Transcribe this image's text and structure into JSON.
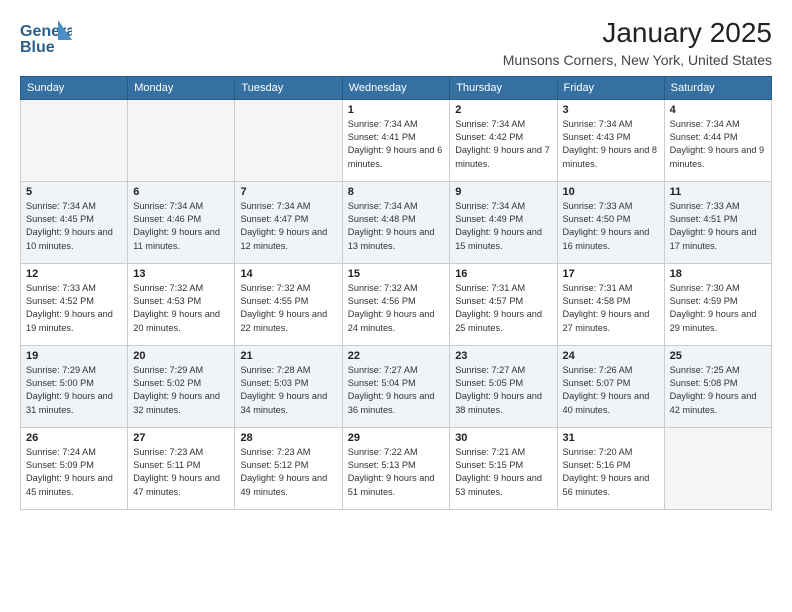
{
  "header": {
    "logo_line1": "General",
    "logo_line2": "Blue",
    "month_title": "January 2025",
    "location": "Munsons Corners, New York, United States"
  },
  "days_of_week": [
    "Sunday",
    "Monday",
    "Tuesday",
    "Wednesday",
    "Thursday",
    "Friday",
    "Saturday"
  ],
  "weeks": [
    [
      {
        "day": "",
        "info": ""
      },
      {
        "day": "",
        "info": ""
      },
      {
        "day": "",
        "info": ""
      },
      {
        "day": "1",
        "info": "Sunrise: 7:34 AM\nSunset: 4:41 PM\nDaylight: 9 hours and 6 minutes."
      },
      {
        "day": "2",
        "info": "Sunrise: 7:34 AM\nSunset: 4:42 PM\nDaylight: 9 hours and 7 minutes."
      },
      {
        "day": "3",
        "info": "Sunrise: 7:34 AM\nSunset: 4:43 PM\nDaylight: 9 hours and 8 minutes."
      },
      {
        "day": "4",
        "info": "Sunrise: 7:34 AM\nSunset: 4:44 PM\nDaylight: 9 hours and 9 minutes."
      }
    ],
    [
      {
        "day": "5",
        "info": "Sunrise: 7:34 AM\nSunset: 4:45 PM\nDaylight: 9 hours and 10 minutes."
      },
      {
        "day": "6",
        "info": "Sunrise: 7:34 AM\nSunset: 4:46 PM\nDaylight: 9 hours and 11 minutes."
      },
      {
        "day": "7",
        "info": "Sunrise: 7:34 AM\nSunset: 4:47 PM\nDaylight: 9 hours and 12 minutes."
      },
      {
        "day": "8",
        "info": "Sunrise: 7:34 AM\nSunset: 4:48 PM\nDaylight: 9 hours and 13 minutes."
      },
      {
        "day": "9",
        "info": "Sunrise: 7:34 AM\nSunset: 4:49 PM\nDaylight: 9 hours and 15 minutes."
      },
      {
        "day": "10",
        "info": "Sunrise: 7:33 AM\nSunset: 4:50 PM\nDaylight: 9 hours and 16 minutes."
      },
      {
        "day": "11",
        "info": "Sunrise: 7:33 AM\nSunset: 4:51 PM\nDaylight: 9 hours and 17 minutes."
      }
    ],
    [
      {
        "day": "12",
        "info": "Sunrise: 7:33 AM\nSunset: 4:52 PM\nDaylight: 9 hours and 19 minutes."
      },
      {
        "day": "13",
        "info": "Sunrise: 7:32 AM\nSunset: 4:53 PM\nDaylight: 9 hours and 20 minutes."
      },
      {
        "day": "14",
        "info": "Sunrise: 7:32 AM\nSunset: 4:55 PM\nDaylight: 9 hours and 22 minutes."
      },
      {
        "day": "15",
        "info": "Sunrise: 7:32 AM\nSunset: 4:56 PM\nDaylight: 9 hours and 24 minutes."
      },
      {
        "day": "16",
        "info": "Sunrise: 7:31 AM\nSunset: 4:57 PM\nDaylight: 9 hours and 25 minutes."
      },
      {
        "day": "17",
        "info": "Sunrise: 7:31 AM\nSunset: 4:58 PM\nDaylight: 9 hours and 27 minutes."
      },
      {
        "day": "18",
        "info": "Sunrise: 7:30 AM\nSunset: 4:59 PM\nDaylight: 9 hours and 29 minutes."
      }
    ],
    [
      {
        "day": "19",
        "info": "Sunrise: 7:29 AM\nSunset: 5:00 PM\nDaylight: 9 hours and 31 minutes."
      },
      {
        "day": "20",
        "info": "Sunrise: 7:29 AM\nSunset: 5:02 PM\nDaylight: 9 hours and 32 minutes."
      },
      {
        "day": "21",
        "info": "Sunrise: 7:28 AM\nSunset: 5:03 PM\nDaylight: 9 hours and 34 minutes."
      },
      {
        "day": "22",
        "info": "Sunrise: 7:27 AM\nSunset: 5:04 PM\nDaylight: 9 hours and 36 minutes."
      },
      {
        "day": "23",
        "info": "Sunrise: 7:27 AM\nSunset: 5:05 PM\nDaylight: 9 hours and 38 minutes."
      },
      {
        "day": "24",
        "info": "Sunrise: 7:26 AM\nSunset: 5:07 PM\nDaylight: 9 hours and 40 minutes."
      },
      {
        "day": "25",
        "info": "Sunrise: 7:25 AM\nSunset: 5:08 PM\nDaylight: 9 hours and 42 minutes."
      }
    ],
    [
      {
        "day": "26",
        "info": "Sunrise: 7:24 AM\nSunset: 5:09 PM\nDaylight: 9 hours and 45 minutes."
      },
      {
        "day": "27",
        "info": "Sunrise: 7:23 AM\nSunset: 5:11 PM\nDaylight: 9 hours and 47 minutes."
      },
      {
        "day": "28",
        "info": "Sunrise: 7:23 AM\nSunset: 5:12 PM\nDaylight: 9 hours and 49 minutes."
      },
      {
        "day": "29",
        "info": "Sunrise: 7:22 AM\nSunset: 5:13 PM\nDaylight: 9 hours and 51 minutes."
      },
      {
        "day": "30",
        "info": "Sunrise: 7:21 AM\nSunset: 5:15 PM\nDaylight: 9 hours and 53 minutes."
      },
      {
        "day": "31",
        "info": "Sunrise: 7:20 AM\nSunset: 5:16 PM\nDaylight: 9 hours and 56 minutes."
      },
      {
        "day": "",
        "info": ""
      }
    ]
  ]
}
